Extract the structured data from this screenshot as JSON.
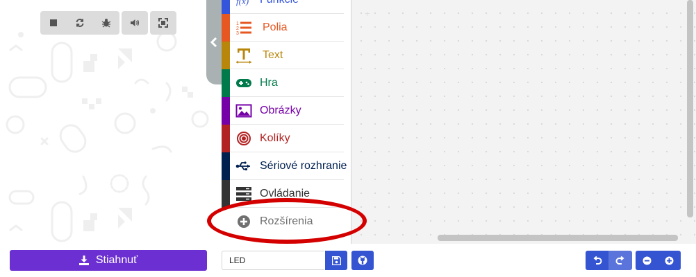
{
  "simulator": {
    "buttons": [
      "stop-icon",
      "restart-icon",
      "debug-icon",
      "sound-icon",
      "fullscreen-icon"
    ]
  },
  "toolbox": {
    "items": [
      {
        "label": "Funkcie",
        "color": "#3455db",
        "icon": "function-icon"
      },
      {
        "label": "Polia",
        "color": "#e65722",
        "icon": "list-icon"
      },
      {
        "label": "Text",
        "color": "#b8860b",
        "icon": "text-icon"
      },
      {
        "label": "Hra",
        "color": "#007a4b",
        "icon": "gamepad-icon"
      },
      {
        "label": "Obrázky",
        "color": "#7600a8",
        "icon": "image-icon"
      },
      {
        "label": "Kolíky",
        "color": "#b22222",
        "icon": "pin-icon"
      },
      {
        "label": "Sériové rozhranie",
        "color": "#002050",
        "icon": "usb-icon"
      },
      {
        "label": "Ovládanie",
        "color": "#333333",
        "icon": "server-icon"
      },
      {
        "label": "Rozšírenia",
        "color": "#ffffff",
        "icon": "plus-circle-icon"
      }
    ]
  },
  "bottom_bar": {
    "download_label": "Stiahnuť",
    "project_name": "LED"
  },
  "colors": {
    "download": "#6c2fd1",
    "blue_button": "#3454d1",
    "highlight": "#d40000"
  }
}
